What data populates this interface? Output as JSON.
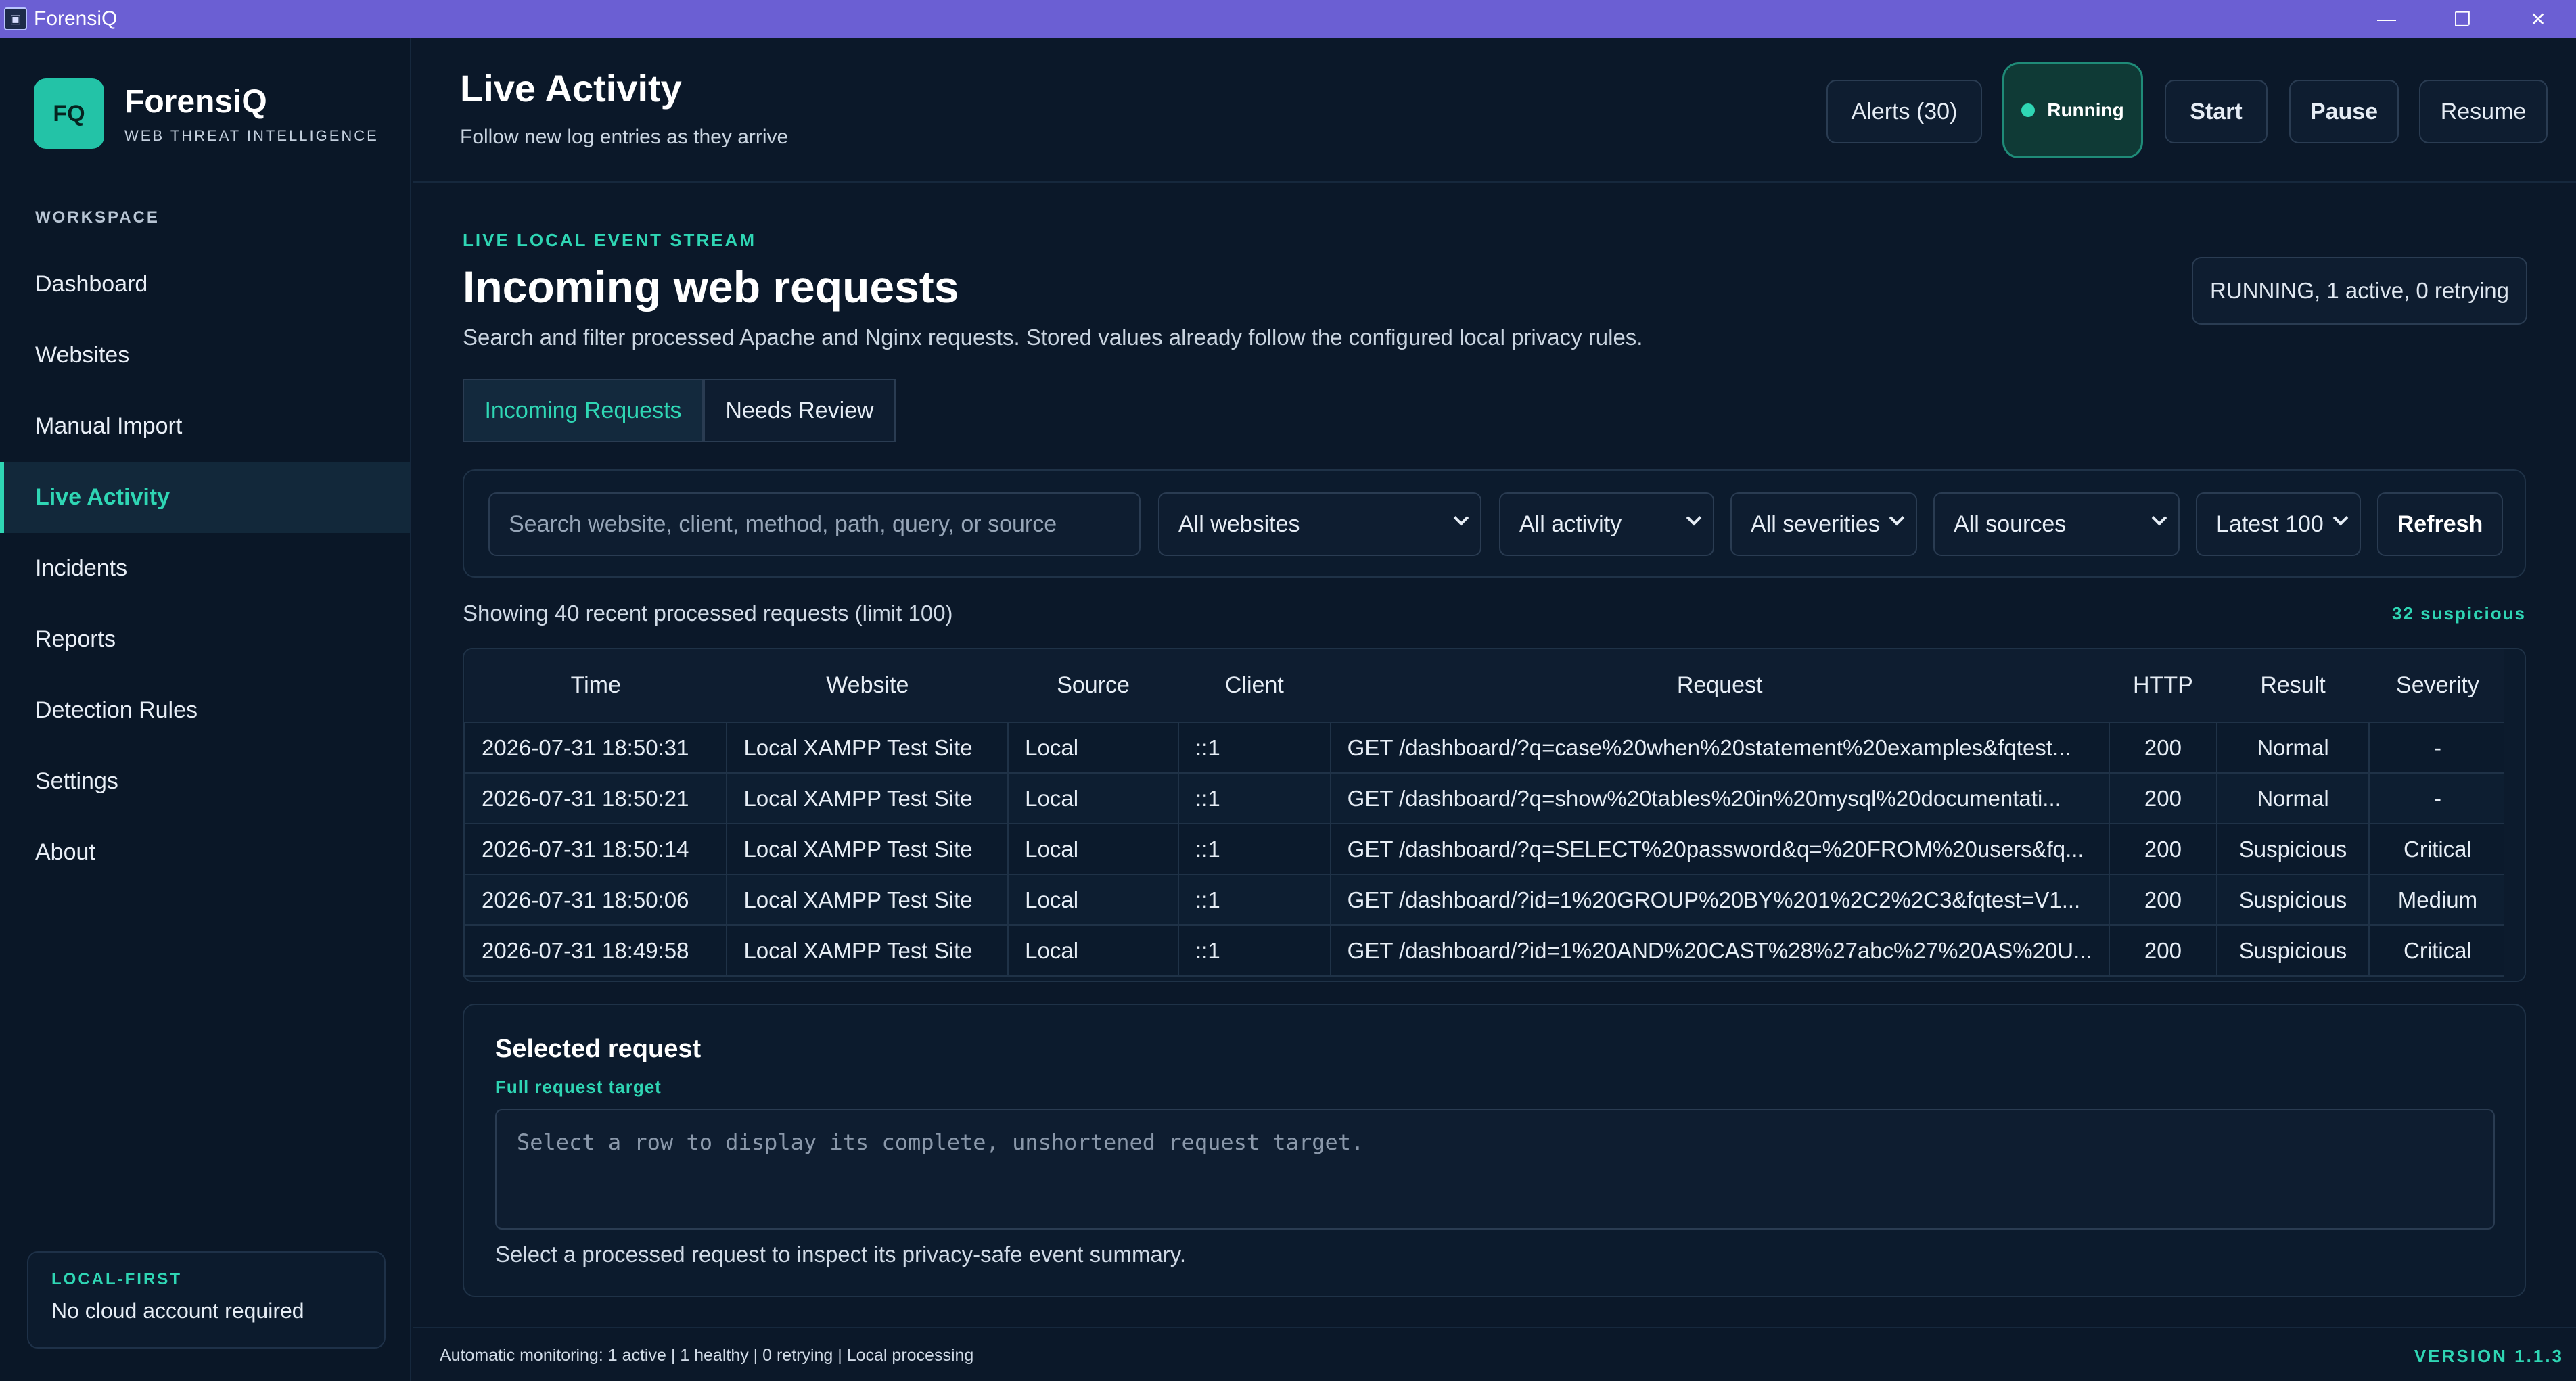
{
  "window": {
    "title": "ForensiQ",
    "min": "—",
    "max": "❐",
    "close": "✕"
  },
  "brand": {
    "logo": "FQ",
    "name": "ForensiQ",
    "tagline": "WEB THREAT INTELLIGENCE"
  },
  "sidebar": {
    "section": "WORKSPACE",
    "items": [
      {
        "label": "Dashboard"
      },
      {
        "label": "Websites"
      },
      {
        "label": "Manual Import"
      },
      {
        "label": "Live Activity"
      },
      {
        "label": "Incidents"
      },
      {
        "label": "Reports"
      },
      {
        "label": "Detection Rules"
      },
      {
        "label": "Settings"
      },
      {
        "label": "About"
      }
    ],
    "card": {
      "title": "LOCAL-FIRST",
      "text": "No cloud account required"
    }
  },
  "header": {
    "title": "Live Activity",
    "subtitle": "Follow new log entries as they arrive",
    "alerts": "Alerts (30)",
    "running": "Running",
    "start": "Start",
    "pause": "Pause",
    "resume": "Resume"
  },
  "main": {
    "eyebrow": "LIVE LOCAL EVENT STREAM",
    "title": "Incoming web requests",
    "description": "Search and filter processed Apache and Nginx requests. Stored values already follow the configured local privacy rules.",
    "status": "RUNNING, 1 active, 0 retrying",
    "tabs": [
      {
        "label": "Incoming Requests"
      },
      {
        "label": "Needs Review"
      }
    ],
    "filters": {
      "search_placeholder": "Search website, client, method, path, query, or source",
      "website": "All websites",
      "activity": "All activity",
      "severity": "All severities",
      "source": "All sources",
      "limit": "Latest 100",
      "refresh": "Refresh"
    },
    "showing": "Showing 40 recent processed requests (limit 100)",
    "suspicious": "32 suspicious",
    "table": {
      "headers": [
        "Time",
        "Website",
        "Source",
        "Client",
        "Request",
        "HTTP",
        "Result",
        "Severity"
      ],
      "rows": [
        [
          "2026-07-31 18:50:31",
          "Local XAMPP Test Site",
          "Local",
          "::1",
          "GET /dashboard/?q=case%20when%20statement%20examples&fqtest...",
          "200",
          "Normal",
          "-"
        ],
        [
          "2026-07-31 18:50:21",
          "Local XAMPP Test Site",
          "Local",
          "::1",
          "GET /dashboard/?q=show%20tables%20in%20mysql%20documentati...",
          "200",
          "Normal",
          "-"
        ],
        [
          "2026-07-31 18:50:14",
          "Local XAMPP Test Site",
          "Local",
          "::1",
          "GET /dashboard/?q=SELECT%20password&q=%20FROM%20users&fq...",
          "200",
          "Suspicious",
          "Critical"
        ],
        [
          "2026-07-31 18:50:06",
          "Local XAMPP Test Site",
          "Local",
          "::1",
          "GET /dashboard/?id=1%20GROUP%20BY%201%2C2%2C3&fqtest=V1...",
          "200",
          "Suspicious",
          "Medium"
        ],
        [
          "2026-07-31 18:49:58",
          "Local XAMPP Test Site",
          "Local",
          "::1",
          "GET /dashboard/?id=1%20AND%20CAST%28%27abc%27%20AS%20U...",
          "200",
          "Suspicious",
          "Critical"
        ]
      ]
    },
    "detail": {
      "title": "Selected request",
      "label": "Full request target",
      "placeholder": "Select a row to display its complete, unshortened request target.",
      "footnote": "Select a processed request to inspect its privacy-safe event summary."
    }
  },
  "footer": {
    "status": "Automatic monitoring: 1 active  |  1 healthy  |  0 retrying  |  Local processing",
    "version": "VERSION 1.1.3"
  },
  "colors": {
    "accent": "#2fd6b4",
    "titlebar": "#6b5fd3",
    "background": "#0b1829"
  }
}
